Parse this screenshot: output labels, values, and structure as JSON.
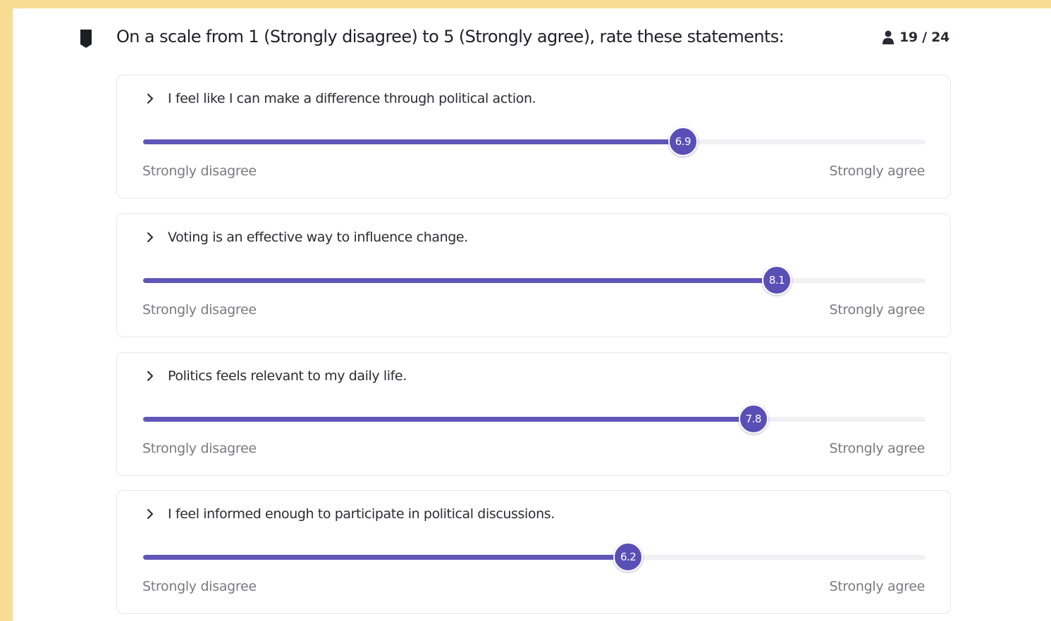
{
  "question": {
    "title": "On a scale from 1 (Strongly disagree) to 5 (Strongly agree), rate these statements:",
    "flag_icon": "bookmark-icon"
  },
  "progress": {
    "icon": "person-icon",
    "text": "19 / 24"
  },
  "colors": {
    "accent": "#5a4fb6",
    "fill": "#6056b8",
    "track": "#f1f1f3",
    "page_border": "#f9dc94"
  },
  "statements": [
    {
      "text": "I feel like I can make a difference through political action.",
      "value_label": "6.9",
      "fraction": 0.69,
      "min_label": "Strongly disagree",
      "max_label": "Strongly agree"
    },
    {
      "text": "Voting is an effective way to influence change.",
      "value_label": "8.1",
      "fraction": 0.81,
      "min_label": "Strongly disagree",
      "max_label": "Strongly agree"
    },
    {
      "text": "Politics feels relevant to my daily life.",
      "value_label": "7.8",
      "fraction": 0.78,
      "min_label": "Strongly disagree",
      "max_label": "Strongly agree"
    },
    {
      "text": "I feel informed enough to participate in political discussions.",
      "value_label": "6.2",
      "fraction": 0.62,
      "min_label": "Strongly disagree",
      "max_label": "Strongly agree"
    }
  ]
}
